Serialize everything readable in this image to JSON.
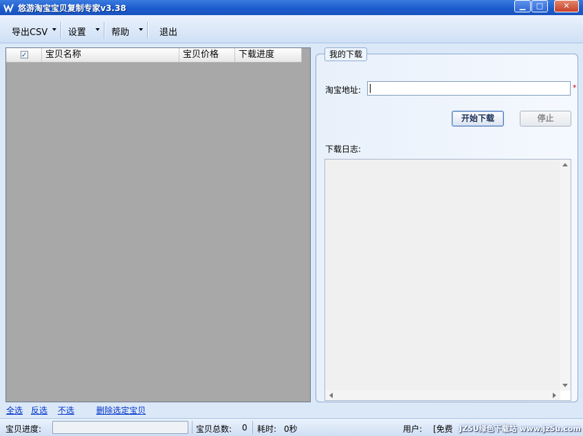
{
  "window": {
    "title": "悠游淘宝宝贝复制专家v3.38"
  },
  "menu": {
    "export_csv": "导出CSV",
    "settings": "设置",
    "help": "帮助",
    "exit": "退出"
  },
  "list": {
    "columns": [
      "宝贝名称",
      "宝贝价格",
      "下载进度"
    ],
    "header_checked": true
  },
  "links": {
    "select_all": "全选",
    "invert": "反选",
    "select_none": "不选",
    "delete_selected": "删除选定宝贝"
  },
  "download": {
    "group_title": "我的下载",
    "url_label": "淘宝地址:",
    "url_value": "",
    "required_mark": "*",
    "start_button": "开始下载",
    "stop_button": "停止",
    "log_label": "下载日志:"
  },
  "status": {
    "progress_label": "宝贝进度:",
    "progress": 0,
    "total_label": "宝贝总数:",
    "total_value": "0",
    "elapsed_label": "耗时:",
    "elapsed_value": "0秒",
    "user_label": "用户:",
    "user_value": "[免费",
    "watermark": "JZ5U绿色下载站 www.jz5u.com"
  },
  "icons": {
    "app": "wave-logo-icon",
    "minimize": "minimize-icon",
    "maximize": "maximize-icon",
    "close": "close-icon"
  }
}
